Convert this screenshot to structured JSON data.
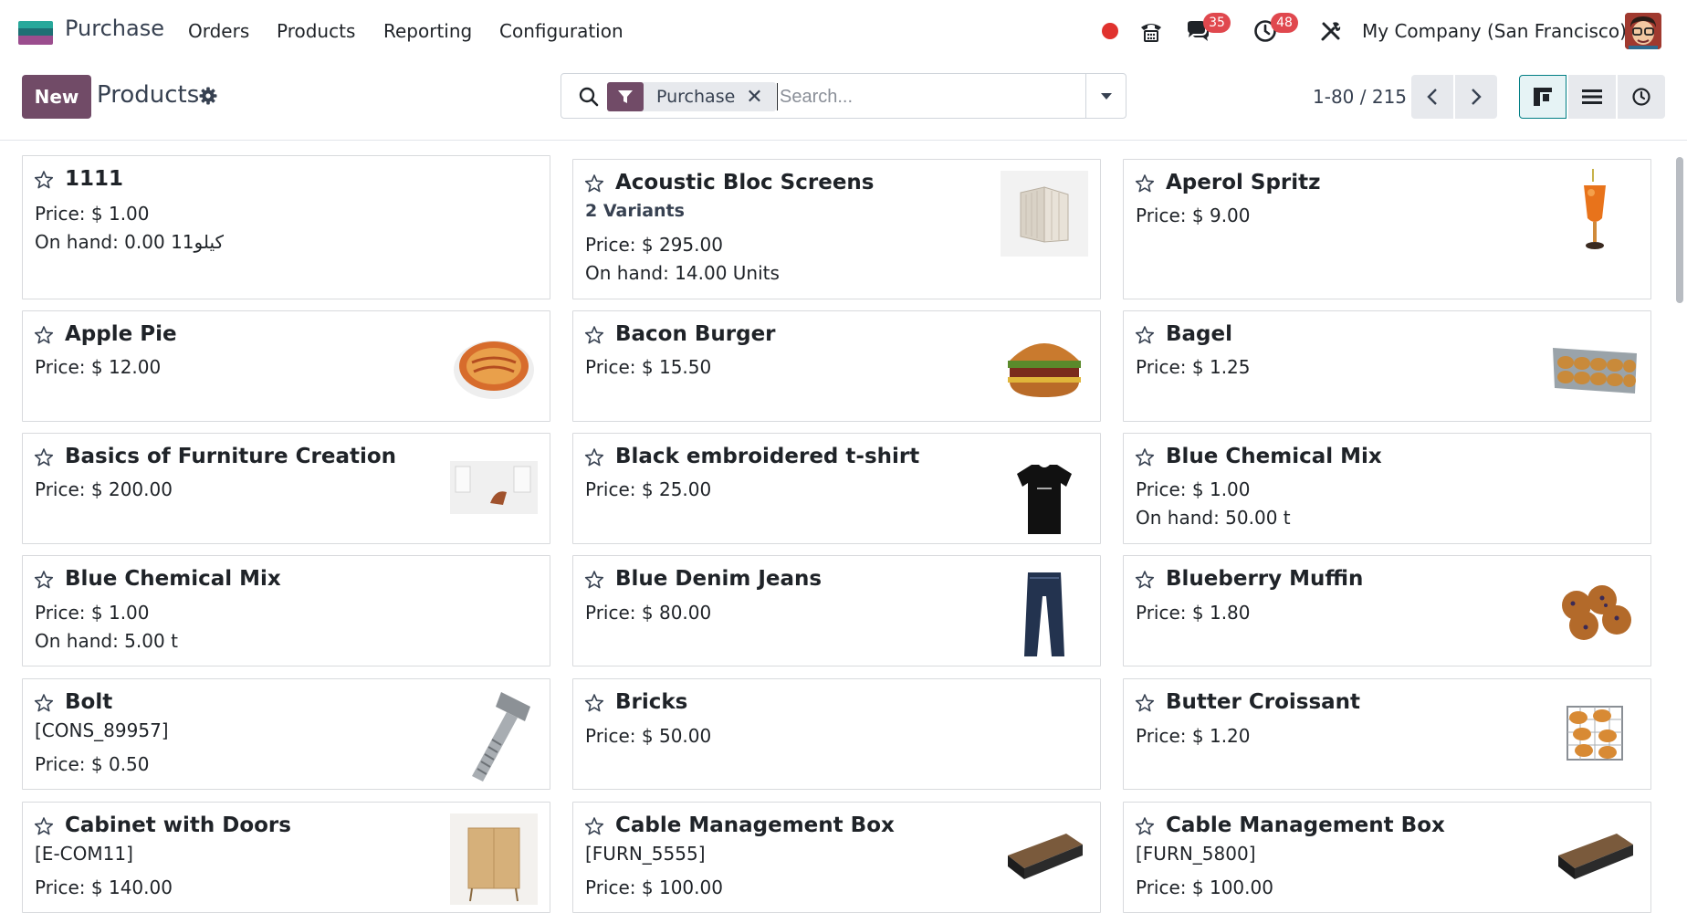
{
  "navbar": {
    "app_name": "Purchase",
    "menu": [
      "Orders",
      "Products",
      "Reporting",
      "Configuration"
    ],
    "discuss_badge": "35",
    "activity_badge": "48",
    "company": "My Company (San Francisco)"
  },
  "control_panel": {
    "new_label": "New",
    "title": "Products",
    "search": {
      "facet_label": "Purchase",
      "placeholder": "Search..."
    },
    "pager": "1-80 / 215"
  },
  "products": [
    {
      "name": "1111",
      "lines": [
        "Price: $ 1.00",
        "On hand: 0.00 كيلو11"
      ],
      "image": "none"
    },
    {
      "name": "Acoustic Bloc Screens",
      "variants": "2 Variants",
      "lines": [
        "Price: $ 295.00",
        "On hand: 14.00 Units"
      ],
      "image": "screen"
    },
    {
      "name": "Aperol Spritz",
      "lines": [
        "Price: $ 9.00"
      ],
      "image": "cocktail"
    },
    {
      "name": "Apple Pie",
      "lines": [
        "Price: $ 12.00"
      ],
      "image": "pie"
    },
    {
      "name": "Bacon Burger",
      "lines": [
        "Price: $ 15.50"
      ],
      "image": "burger"
    },
    {
      "name": "Bagel",
      "lines": [
        "Price: $ 1.25"
      ],
      "image": "bagels"
    },
    {
      "name": "Basics of Furniture Creation",
      "lines": [
        "Price: $ 200.00"
      ],
      "image": "room"
    },
    {
      "name": "Black embroidered t-shirt",
      "lines": [
        "Price: $ 25.00"
      ],
      "image": "tshirt"
    },
    {
      "name": "Blue Chemical Mix",
      "lines": [
        "Price: $ 1.00",
        "On hand: 50.00 t"
      ],
      "image": "none"
    },
    {
      "name": "Blue Chemical Mix",
      "lines": [
        "Price: $ 1.00",
        "On hand: 5.00 t"
      ],
      "image": "none"
    },
    {
      "name": "Blue Denim Jeans",
      "lines": [
        "Price: $ 80.00"
      ],
      "image": "jeans"
    },
    {
      "name": "Blueberry Muffin",
      "lines": [
        "Price: $ 1.80"
      ],
      "image": "muffin"
    },
    {
      "name": "Bolt",
      "lines": [
        "[CONS_89957]",
        "Price: $ 0.50"
      ],
      "image": "bolt"
    },
    {
      "name": "Bricks",
      "lines": [
        "Price: $ 50.00"
      ],
      "image": "none"
    },
    {
      "name": "Butter Croissant",
      "lines": [
        "Price: $ 1.20"
      ],
      "image": "croissant"
    },
    {
      "name": "Cabinet with Doors",
      "lines": [
        "[E-COM11]",
        "Price: $ 140.00"
      ],
      "image": "cabinet"
    },
    {
      "name": "Cable Management Box",
      "lines": [
        "[FURN_5555]",
        "Price: $ 100.00"
      ],
      "image": "cablebox"
    },
    {
      "name": "Cable Management Box",
      "lines": [
        "[FURN_5800]",
        "Price: $ 100.00"
      ],
      "image": "cablebox"
    }
  ]
}
